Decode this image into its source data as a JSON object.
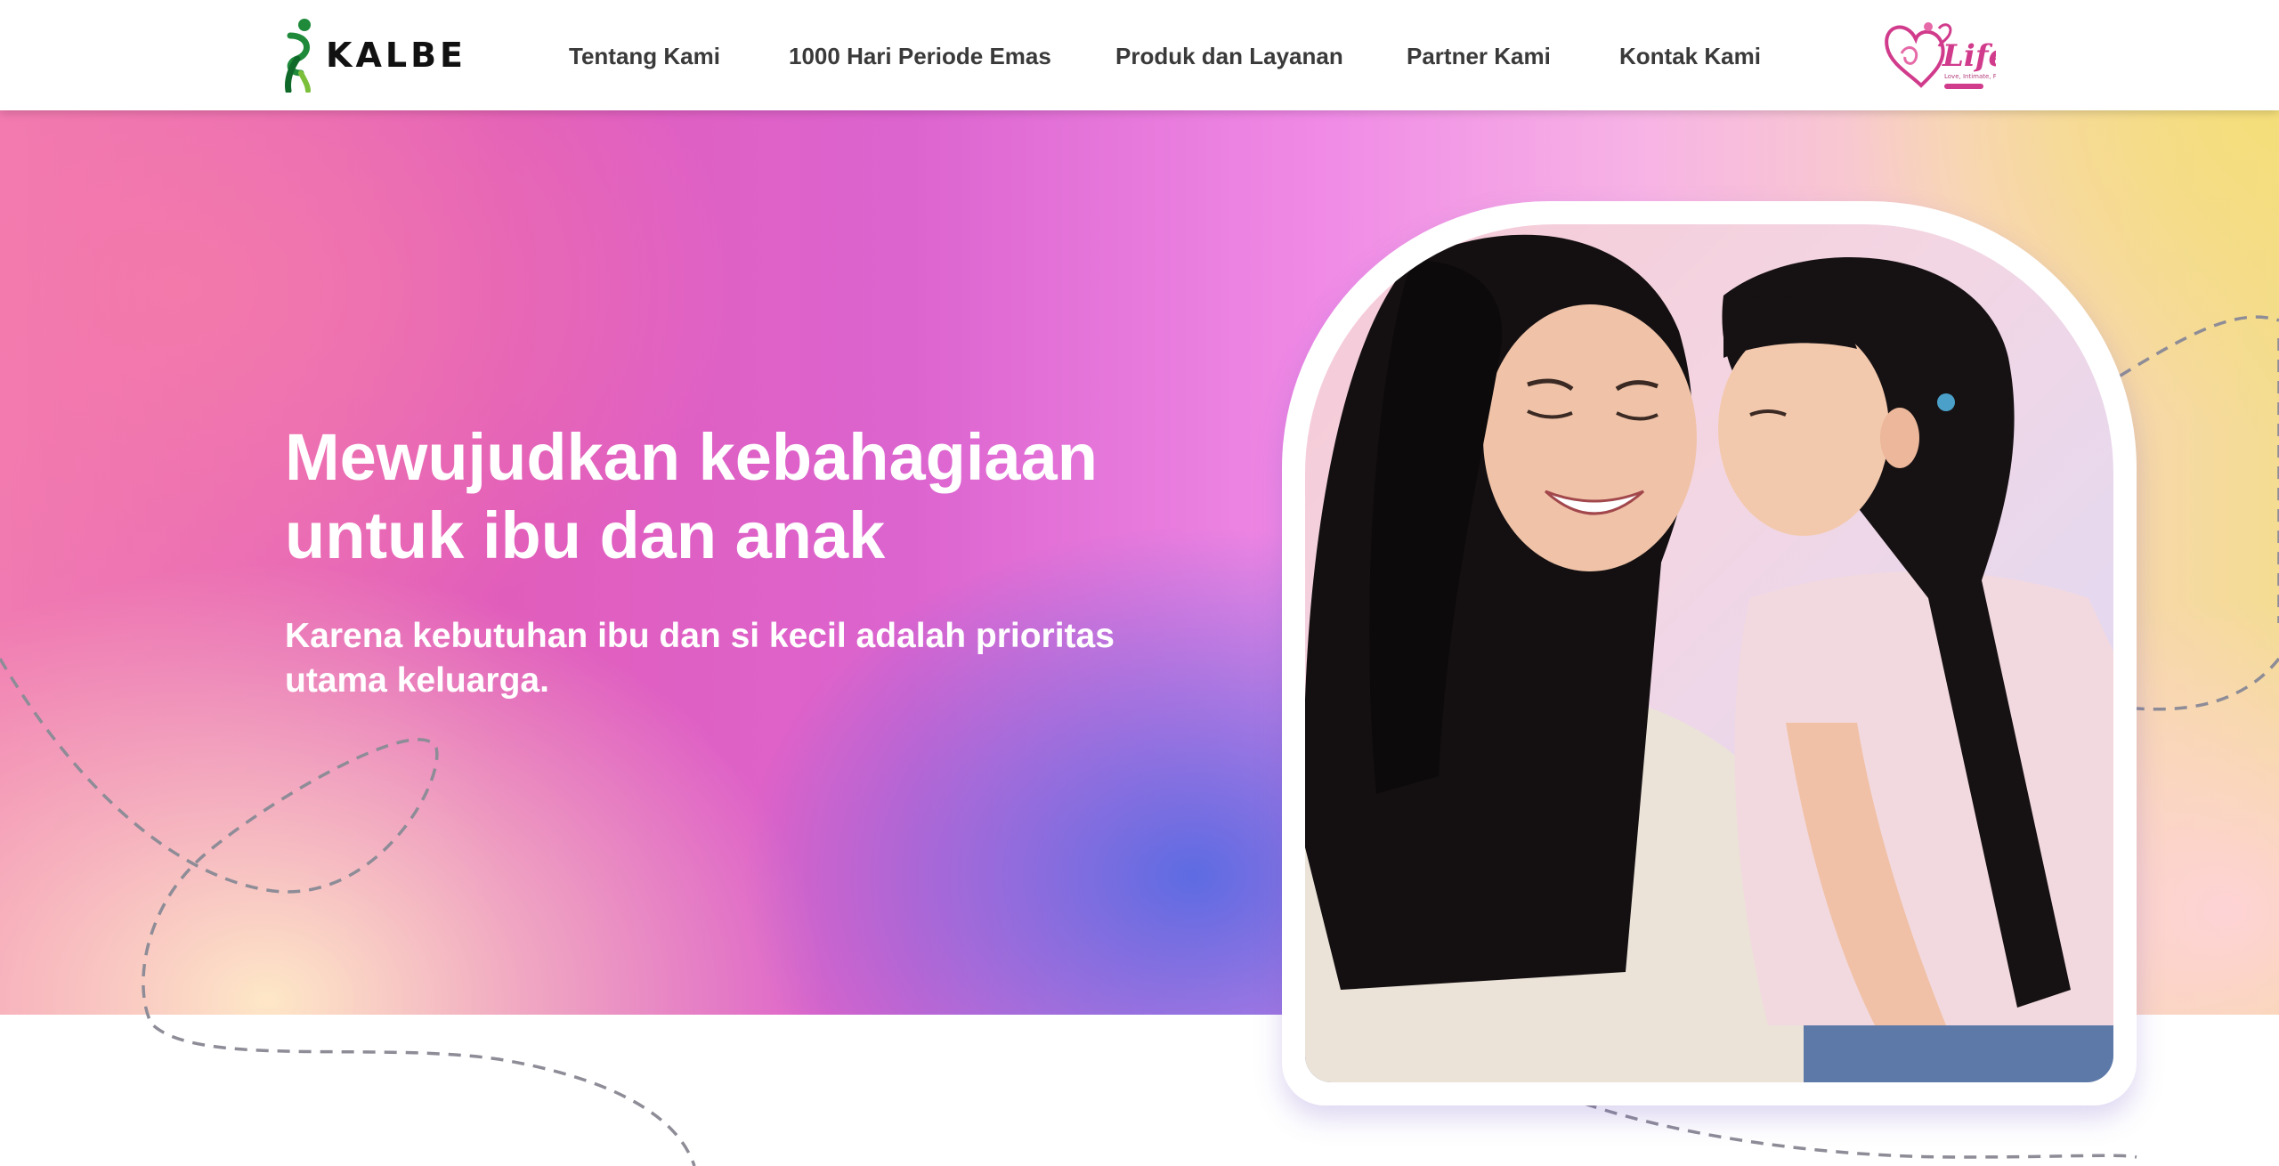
{
  "header": {
    "brand_name": "KALBE",
    "nav": [
      {
        "label": "Tentang Kami"
      },
      {
        "label": "1000 Hari Periode Emas"
      },
      {
        "label": "Produk dan Layanan"
      },
      {
        "label": "Partner Kami"
      },
      {
        "label": "Kontak Kami"
      }
    ],
    "partner_logo": {
      "text": "Life",
      "tagline": "Love, Intimate, Fun, Explore"
    }
  },
  "hero": {
    "title_line1": "Mewujudkan kebahagiaan",
    "title_line2": "untuk ibu dan anak",
    "subtitle_line1": "Karena kebutuhan ibu dan si kecil adalah prioritas",
    "subtitle_line2": "utama keluarga."
  },
  "colors": {
    "brand_green": "#1e8a3a",
    "brand_dark": "#111111",
    "nav_text": "#3a3a3a",
    "life_pink": "#d13b8c",
    "hero_text": "#ffffff"
  },
  "icons": {
    "brand": "kalbe-figure-icon",
    "partner": "heart-life-logo"
  }
}
